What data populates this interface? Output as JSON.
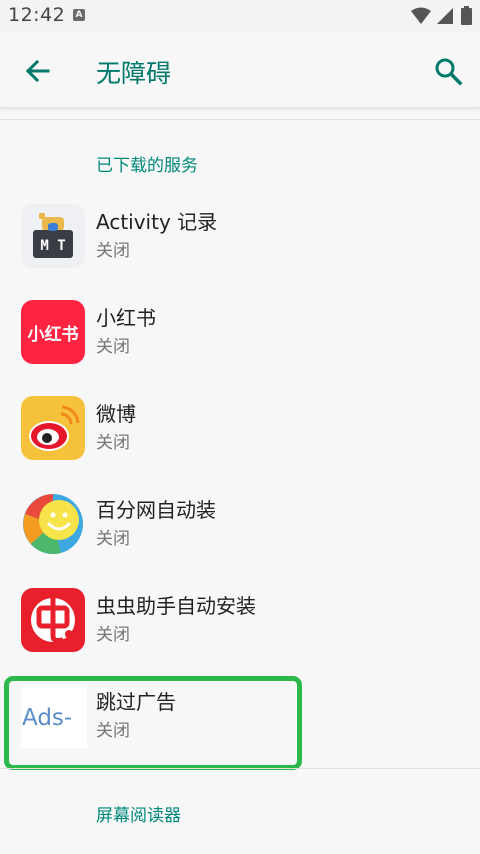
{
  "status_bar": {
    "time": "12:42",
    "notification_icon": "android-auto-icon",
    "icons": [
      "wifi-icon",
      "signal-icon",
      "battery-icon"
    ]
  },
  "app_bar": {
    "title": "无障碍",
    "back_icon": "arrow-back-icon",
    "search_icon": "search-icon",
    "accent_color": "#00796b"
  },
  "sections": {
    "downloaded_services": "已下载的服务",
    "screen_reader": "屏幕阅读器"
  },
  "services": [
    {
      "name": "Activity 记录",
      "status": "关闭",
      "icon": "mt-activity-icon"
    },
    {
      "name": "小红书",
      "status": "关闭",
      "icon": "xiaohongshu-icon"
    },
    {
      "name": "微博",
      "status": "关闭",
      "icon": "weibo-icon"
    },
    {
      "name": "百分网自动装",
      "status": "关闭",
      "icon": "baifen-icon"
    },
    {
      "name": "虫虫助手自动安装",
      "status": "关闭",
      "icon": "chongchong-icon"
    },
    {
      "name": "跳过广告",
      "status": "关闭",
      "icon": "ads-skip-icon",
      "icon_text": "Ads-",
      "highlighted": true
    }
  ],
  "highlight_color": "#2db84b"
}
